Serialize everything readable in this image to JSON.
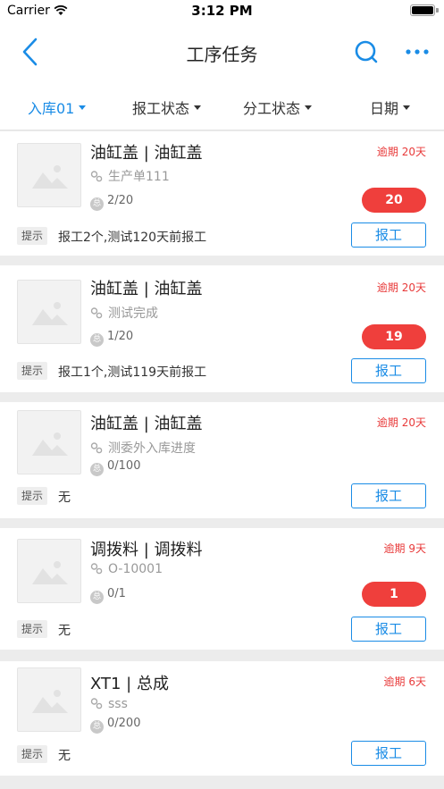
{
  "status_bar": {
    "carrier": "Carrier",
    "time": "3:12 PM"
  },
  "nav": {
    "title": "工序任务"
  },
  "filters": [
    {
      "label": "入库01",
      "active": true
    },
    {
      "label": "报工状态",
      "active": false
    },
    {
      "label": "分工状态",
      "active": false
    },
    {
      "label": "日期",
      "active": false
    }
  ],
  "colors": {
    "accent": "#1a8ce6",
    "danger": "#ef3f3c"
  },
  "tip_label": "提示",
  "report_label": "报工",
  "cards": [
    {
      "title": "油缸盖 | 油缸盖",
      "overdue": "逾期 20天",
      "order": "生产单111",
      "total_icon": "总",
      "total": "2/20",
      "badge": "20",
      "tip": "报工2个,测试120天前报工"
    },
    {
      "title": "油缸盖 | 油缸盖",
      "overdue": "逾期 20天",
      "order": "测试完成",
      "total_icon": "总",
      "total": "1/20",
      "badge": "19",
      "tip": "报工1个,测试119天前报工"
    },
    {
      "title": "油缸盖 | 油缸盖",
      "overdue": "逾期 20天",
      "order": "测委外入库进度",
      "total_icon": "总",
      "total": "0/100",
      "badge": "",
      "tip": "无"
    },
    {
      "title": "调拨料 | 调拨料",
      "overdue": "逾期 9天",
      "order": "O-10001",
      "total_icon": "总",
      "total": "0/1",
      "badge": "1",
      "tip": "无"
    },
    {
      "title": "XT1 | 总成",
      "overdue": "逾期 6天",
      "order": "sss",
      "total_icon": "总",
      "total": "0/200",
      "badge": "",
      "tip": "无"
    }
  ]
}
